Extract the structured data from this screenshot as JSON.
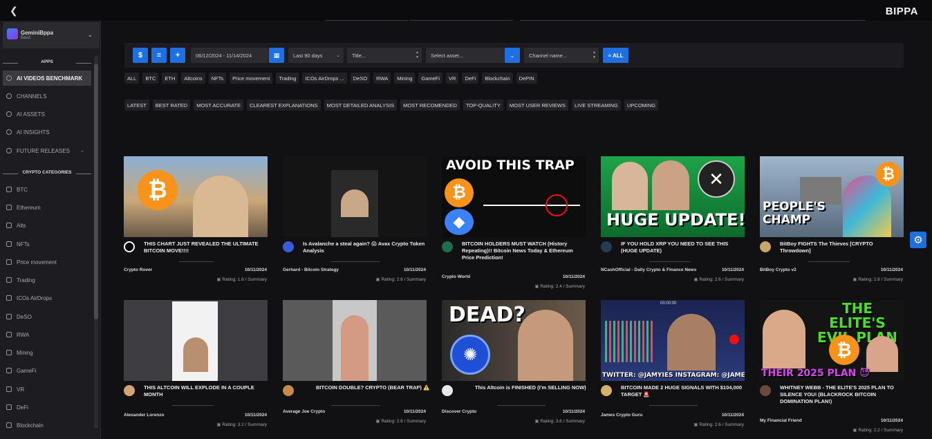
{
  "brand": "BIPPA",
  "user": {
    "name": "GeminiBppa",
    "plan": "Basic"
  },
  "sidebar": {
    "apps_title": "APPS",
    "apps": [
      {
        "label": "AI VIDEOS BENCHMARK",
        "icon": "search-icon",
        "active": true
      },
      {
        "label": "CHANNELS",
        "icon": "search-icon"
      },
      {
        "label": "AI ASSETS",
        "icon": "eye-icon"
      },
      {
        "label": "AI INSIGHTS",
        "icon": "eye-icon"
      },
      {
        "label": "FUTURE RELEASES",
        "icon": "clock-icon",
        "caret": true
      }
    ],
    "categories_title": "CRYPTO CATEGORIES",
    "categories": [
      "BTC",
      "Ethereum",
      "Alts",
      "NFTs",
      "Price movement",
      "Trading",
      "ICOs AirDrops",
      "DeSO",
      "RWA",
      "Mining",
      "GameFi",
      "VR",
      "DeFi",
      "Blockchain"
    ]
  },
  "toolbar": {
    "dollar_label": "$",
    "list_label": "≡",
    "plus_label": "+",
    "date_range": "06/12/2024 - 11/14/2024",
    "period": "Last 90 days",
    "title_placeholder": "Title...",
    "asset_placeholder": "Select asset...",
    "channel_placeholder": "Channel name...",
    "all_label": "≡ ALL"
  },
  "category_chips": [
    "ALL",
    "BTC",
    "ETH",
    "Altcoins",
    "NFTs",
    "Price movement",
    "Trading",
    "ICOs AirDrops ...",
    "DeSO",
    "RWA",
    "Mining",
    "GameFi",
    "VR",
    "DeFi",
    "Blockchain",
    "DePIN"
  ],
  "sort_chips": [
    "LATEST",
    "BEST RATED",
    "MOST ACCURATE",
    "CLEAREST EXPLANATIONS",
    "MOST DETAILED ANALYSIS",
    "MOST RECOMENDED",
    "TOP-QUALITY",
    "MOST USER REVIEWS",
    "LIVE STREAMING",
    "UPCOMING"
  ],
  "videos": [
    {
      "title": "THIS CHART JUST REVEALED THE ULTIMATE BITCOIN MOVE!!!!",
      "channel": "Crypto Rover",
      "date": "10/11/2024",
      "rating": "Rating: 1.6 / Summary",
      "thumb_text": "",
      "bg": "#5b6f86"
    },
    {
      "title": "Is Avalanche a steal again? 😱 Avax Crypto Token Analysis",
      "channel": "Gerhard - Bitcoin Strategy",
      "date": "10/11/2024",
      "rating": "Rating: 2.6 / Summary",
      "thumb_text": "",
      "bg": "#1a1a1a"
    },
    {
      "title": "BITCOIN HOLDERS MUST WATCH (History Repeating)!! Bitcoin News Today & Ethereum Price Prediction!",
      "channel": "Crypto World",
      "date": "10/11/2024",
      "rating": "Rating: 2.4 / Summary",
      "thumb_text": "AVOID THIS TRAP",
      "bg": "#0c0c0c"
    },
    {
      "title": "IF YOU HOLD XRP YOU NEED TO SEE THIS (HUGE UPDATE)",
      "channel": "NCashOfficial - Daily Crypto & Finance News",
      "date": "10/11/2024",
      "rating": "Rating: 2.6 / Summary",
      "thumb_text": "HUGE UPDATE!",
      "bg": "#14a34a"
    },
    {
      "title": "BitBoy FIGHTS The Thieves [CRYPTO Throwdown]",
      "channel": "BitBoy Crypto v2",
      "date": "10/11/2024",
      "rating": "Rating: 2.8 / Summary",
      "thumb_text": "PEOPLE'S CHAMP",
      "bg": "#6a7f94"
    },
    {
      "title": "THIS ALTCOIN WILL EXPLODE IN A COUPLE MONTH",
      "channel": "Alexander Lorenzo",
      "date": "10/11/2024",
      "rating": "Rating: 3.2 / Summary",
      "thumb_text": "",
      "bg": "#4a4a4a"
    },
    {
      "title": "BITCOIN DOUBLE? CRYPTO (BEAR TRAP) ⚠️",
      "channel": "Average Joe Crypto",
      "date": "10/11/2024",
      "rating": "Rating: 2.8 / Summary",
      "thumb_text": "",
      "bg": "#6b6b6b"
    },
    {
      "title": "This Altcoin is FINISHED (I'm SELLING NOW)",
      "channel": "Discover Crypto",
      "date": "10/11/2024",
      "rating": "Rating: 3.6 / Summary",
      "thumb_text": "DEAD?",
      "bg": "#202020"
    },
    {
      "title": "BITCOIN MADE 2 HUGE SIGNALS WITH $104,000 TARGET 🚨",
      "channel": "James Crypto Guru",
      "date": "10/11/2024",
      "rating": "Rating: 2.6 / Summary",
      "thumb_text": "TWITTER: @JAMYIES  INSTAGRAM: @JAMESCRYPTOG",
      "bg": "#1b2a5c"
    },
    {
      "title": "WHITNEY WEBB - THE ELITE'S 2025 PLAN TO SILENCE YOU! (BLACKROCK BITCOIN DOMINATION PLAN!)",
      "channel": "My Financial Friend",
      "date": "10/11/2024",
      "rating": "Rating: 2.2 / Summary",
      "thumb_text": "THE ELITE'S EVIL PLAN",
      "bg": "#1a1a1a"
    }
  ],
  "thumb_extra": {
    "v9_sub": "THEIR 2025 PLAN 😈",
    "v9_time": "00:00:00"
  },
  "colors": {
    "accent": "#1e6fe0",
    "bg": "#111114",
    "sidebar": "#1d1d21"
  }
}
